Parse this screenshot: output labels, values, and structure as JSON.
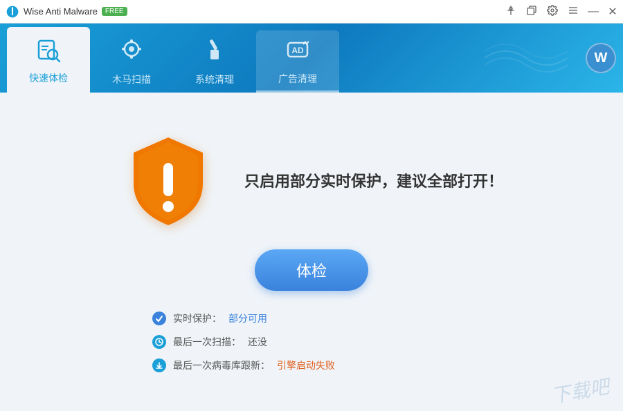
{
  "titleBar": {
    "appName": "Wise Anti Malware",
    "badge": "FREE",
    "controls": {
      "pin": "📌",
      "restore": "🗗",
      "settings": "⚙",
      "menu": "≡",
      "minimize": "—",
      "close": "✕"
    }
  },
  "nav": {
    "tabs": [
      {
        "id": "quick-scan",
        "label": "快速体检",
        "icon": "🔍",
        "active": true
      },
      {
        "id": "trojan-scan",
        "label": "木马扫描",
        "icon": "🎯",
        "active": false
      },
      {
        "id": "system-clean",
        "label": "系统清理",
        "icon": "🧹",
        "active": false
      },
      {
        "id": "ad-clean",
        "label": "广告清理",
        "icon": "AD",
        "active": false
      }
    ],
    "userAvatarLabel": "W"
  },
  "main": {
    "warningText": "只启用部分实时保护，建议全部打开！",
    "scanButtonLabel": "体检",
    "statusItems": [
      {
        "id": "realtime",
        "label": "实时保护：",
        "value": "部分可用",
        "valueType": "link"
      },
      {
        "id": "last-scan",
        "label": "最后一次扫描：",
        "value": "还没",
        "valueType": "text"
      },
      {
        "id": "last-update",
        "label": "最后一次病毒库跟新：",
        "value": "引擎启动失败",
        "valueType": "link-red"
      }
    ]
  },
  "watermark": "下载吧"
}
